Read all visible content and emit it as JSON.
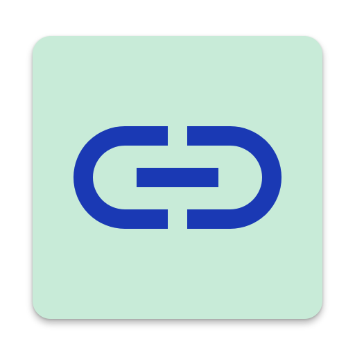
{
  "icon": {
    "name": "link-icon",
    "background_color": "#c8ebd8",
    "glyph_color": "#1a39b4"
  }
}
